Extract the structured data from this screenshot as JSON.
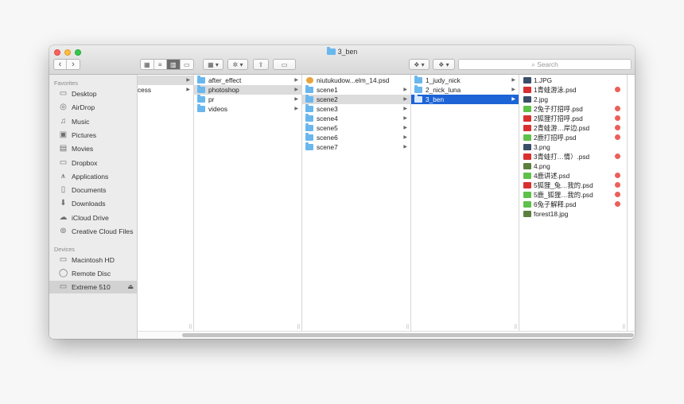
{
  "window": {
    "title": "3_ben"
  },
  "toolbar": {
    "back": "‹",
    "forward": "›",
    "view_icons": "▦",
    "view_list": "≡",
    "view_columns": "▥",
    "view_cover": "▭",
    "arrange": "▦ ▾",
    "action": "✲ ▾",
    "share": "⇪",
    "tag": "▭",
    "dropbox": "❖ ▾",
    "dropbox2": "❖ ▾",
    "search_placeholder": "Search"
  },
  "sidebar": {
    "favorites_header": "Favorites",
    "favorites": [
      {
        "label": "Desktop",
        "icon": "desktop-icon"
      },
      {
        "label": "AirDrop",
        "icon": "airdrop-icon"
      },
      {
        "label": "Music",
        "icon": "music-icon"
      },
      {
        "label": "Pictures",
        "icon": "pictures-icon"
      },
      {
        "label": "Movies",
        "icon": "movies-icon"
      },
      {
        "label": "Dropbox",
        "icon": "folder-icon"
      },
      {
        "label": "Applications",
        "icon": "applications-icon"
      },
      {
        "label": "Documents",
        "icon": "documents-icon"
      },
      {
        "label": "Downloads",
        "icon": "downloads-icon"
      },
      {
        "label": "iCloud Drive",
        "icon": "cloud-icon"
      },
      {
        "label": "Creative Cloud Files",
        "icon": "creative-cloud-icon"
      }
    ],
    "devices_header": "Devices",
    "devices": [
      {
        "label": "Macintosh HD",
        "icon": "disk-icon"
      },
      {
        "label": "Remote Disc",
        "icon": "disc-icon"
      },
      {
        "label": "Extreme 510",
        "icon": "disk-icon",
        "eject": "⏏"
      }
    ]
  },
  "columns": {
    "col0": [
      "",
      "cess"
    ],
    "col1": [
      "after_effect",
      "photoshop",
      "pr",
      "videos"
    ],
    "col2": [
      "niutukudow...elm_14.psd",
      "scene1",
      "scene2",
      "scene3",
      "scene4",
      "scene5",
      "scene6",
      "scene7"
    ],
    "col3": [
      "1_judy_nick",
      "2_nick_luna",
      "3_ben"
    ],
    "col4": [
      {
        "name": "1.JPG",
        "kind": "jpg",
        "tag": false
      },
      {
        "name": "1青蛙游泳.psd",
        "kind": "psd-red",
        "tag": true
      },
      {
        "name": "2.jpg",
        "kind": "jpg",
        "tag": false
      },
      {
        "name": "2兔子打招呼.psd",
        "kind": "psd-grn",
        "tag": true
      },
      {
        "name": "2狐狸打招呼.psd",
        "kind": "psd-red",
        "tag": true
      },
      {
        "name": "2青蛙游…岸边.psd",
        "kind": "psd-red",
        "tag": true
      },
      {
        "name": "2鹿打招呼.psd",
        "kind": "psd-grn",
        "tag": true
      },
      {
        "name": "3.png",
        "kind": "jpg",
        "tag": false
      },
      {
        "name": "3青蛙打…情）.psd",
        "kind": "psd-red",
        "tag": true
      },
      {
        "name": "4.png",
        "kind": "jpg-g",
        "tag": false
      },
      {
        "name": "4鹿讲述.psd",
        "kind": "psd-grn",
        "tag": true
      },
      {
        "name": "5狐狸_兔…我的.psd",
        "kind": "psd-red",
        "tag": true
      },
      {
        "name": "5鹿_狐狸…我的.psd",
        "kind": "psd-grn",
        "tag": true
      },
      {
        "name": "6兔子解释.psd",
        "kind": "psd-grn",
        "tag": true
      },
      {
        "name": "forest18.jpg",
        "kind": "jpg-g",
        "tag": false
      }
    ]
  },
  "colors": {
    "selection": "#1d64d6",
    "tag_red": "#ec5f59",
    "folder": "#6ab7ee"
  }
}
